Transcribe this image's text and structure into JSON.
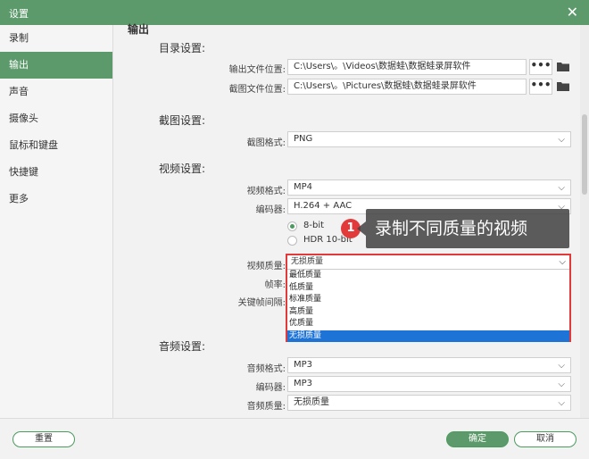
{
  "window": {
    "title": "设置"
  },
  "sidebar": {
    "items": [
      {
        "label": "录制"
      },
      {
        "label": "输出",
        "active": true
      },
      {
        "label": "声音"
      },
      {
        "label": "摄像头"
      },
      {
        "label": "鼠标和键盘"
      },
      {
        "label": "快捷键"
      },
      {
        "label": "更多"
      }
    ]
  },
  "content": {
    "output_heading": "输出",
    "directory": {
      "heading": "目录设置:",
      "output_label": "输出文件位置:",
      "output_value": "C:\\Users\\。\\Videos\\数据蛙\\数据蛙录屏软件",
      "screenshot_label": "截图文件位置:",
      "screenshot_value": "C:\\Users\\。\\Pictures\\数据蛙\\数据蛙录屏软件",
      "browse_label": "•••"
    },
    "screenshot": {
      "heading": "截图设置:",
      "format_label": "截图格式:",
      "format_value": "PNG"
    },
    "video": {
      "heading": "视频设置:",
      "format_label": "视频格式:",
      "format_value": "MP4",
      "encoder_label": "编码器:",
      "encoder_value": "H.264 + AAC",
      "bit8_label": "8-bit",
      "hdr_label": "HDR 10-bit",
      "quality_label": "视频质量:",
      "quality_value": "无损质量",
      "framerate_label": "帧率:",
      "keyframe_label": "关键帧间隔:",
      "quality_options": [
        "最低质量",
        "低质量",
        "标准质量",
        "高质量",
        "优质量",
        "无损质量"
      ],
      "quality_selected": "无损质量"
    },
    "audio": {
      "heading": "音频设置:",
      "format_label": "音频格式:",
      "format_value": "MP3",
      "encoder_label": "编码器:",
      "encoder_value": "MP3",
      "quality_label": "音频质量:",
      "quality_value": "无损质量"
    }
  },
  "annotation": {
    "step_number": "1",
    "text": "录制不同质量的视频"
  },
  "footer": {
    "reset_label": "重置",
    "ok_label": "确定",
    "cancel_label": "取消"
  },
  "colors": {
    "accent": "#5d9a6b",
    "highlight_border": "#e23a3a",
    "selected_option": "#1e73d6"
  }
}
